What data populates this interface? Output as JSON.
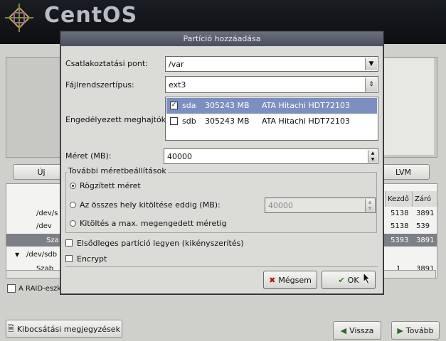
{
  "brand": {
    "name": "CentOS"
  },
  "background": {
    "new_button": "Új",
    "lvm_button": "LVM",
    "columns": [
      "Kezdő",
      "Záró"
    ],
    "rows": [
      {
        "device": "/dev/s",
        "start": "5138",
        "end": "3891"
      },
      {
        "device": "/dev",
        "start": "5138",
        "end": "539"
      },
      {
        "device": "Sza",
        "start": "5393",
        "end": "3891"
      },
      {
        "device": "/dev/sdb",
        "start": "",
        "end": ""
      },
      {
        "device": "Szab",
        "start": "1",
        "end": "3891"
      }
    ],
    "raid_checkbox": "A RAID-eszk",
    "notes_button": "Kibocsátási megjegyzések",
    "back_button": "Vissza",
    "next_button": "Tovább"
  },
  "dialog": {
    "title": "Partíció hozzáadása",
    "mount_label": "Csatlakoztatási pont:",
    "mount_value": "/var",
    "fstype_label": "Fájlrendszertípus:",
    "fstype_value": "ext3",
    "drives_label": "Engedélyezett meghajtók:",
    "drives": [
      {
        "checked": true,
        "name": "sda",
        "size": "305243 MB",
        "model": "ATA Hitachi HDT72103"
      },
      {
        "checked": false,
        "name": "sdb",
        "size": "305243 MB",
        "model": "ATA Hitachi HDT72103"
      }
    ],
    "size_label": "Méret (MB):",
    "size_value": "40000",
    "more_options_title": "További méretbeállítások",
    "fixed_size": "Rögzített méret",
    "fill_up_to": "Az összes hely kitöltése eddig (MB):",
    "fill_up_to_value": "40000",
    "fill_max": "Kitöltés a max. megengedett méretig",
    "primary_partition": "Elsődleges partíció legyen (kikényszerítés)",
    "encrypt": "Encrypt",
    "cancel_button": "Mégsem",
    "ok_button": "OK"
  },
  "colors": {
    "titlebar": "#4a4f5c",
    "selection": "#7d8fc0",
    "dialog_bg": "#dbdcd8"
  }
}
